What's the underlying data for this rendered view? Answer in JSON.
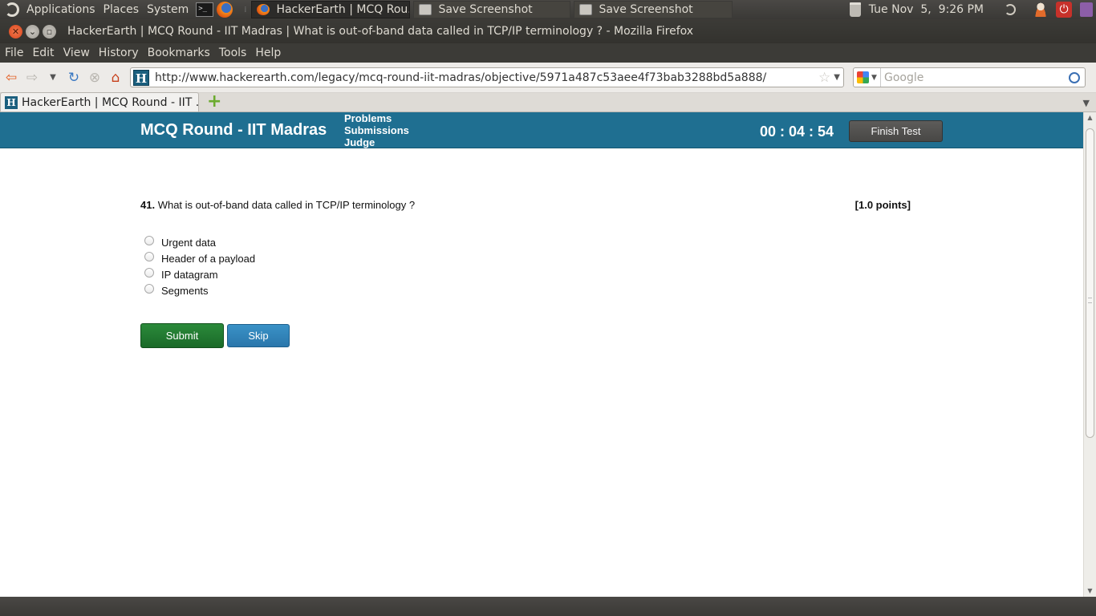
{
  "gnome_panel": {
    "menus": [
      "Applications",
      "Places",
      "System"
    ],
    "tasks": [
      {
        "label": "HackerEarth | MCQ Rou...",
        "icon": "firefox-icon"
      },
      {
        "label": "Save Screenshot",
        "icon": "camera-icon"
      },
      {
        "label": "Save Screenshot",
        "icon": "camera-icon"
      }
    ],
    "clock": "Tue Nov  5,  9:26 PM"
  },
  "window": {
    "title": "HackerEarth | MCQ Round - IIT Madras | What is out-of-band data called in TCP/IP terminology ? - Mozilla Firefox"
  },
  "menubar": {
    "items": [
      "File",
      "Edit",
      "View",
      "History",
      "Bookmarks",
      "Tools",
      "Help"
    ]
  },
  "navbar": {
    "url": "http://www.hackerearth.com/legacy/mcq-round-iit-madras/objective/5971a487c53aee4f73bab3288bd5a888/",
    "search_placeholder": "Google"
  },
  "tabs": {
    "active_tab": "HackerEarth | MCQ Round - IIT ..."
  },
  "site": {
    "favicon_letter": "H",
    "contest_title": "MCQ Round - IIT Madras",
    "nav": [
      "Problems",
      "Submissions",
      "Judge"
    ],
    "timer": "00 : 04 : 54",
    "finish_label": "Finish Test"
  },
  "question": {
    "number": "41.",
    "text": "What is out-of-band data called in TCP/IP terminology ?",
    "points": "[1.0 points]",
    "options": [
      "Urgent data",
      "Header of a payload",
      "IP datagram",
      "Segments"
    ],
    "submit_label": "Submit",
    "skip_label": "Skip"
  }
}
